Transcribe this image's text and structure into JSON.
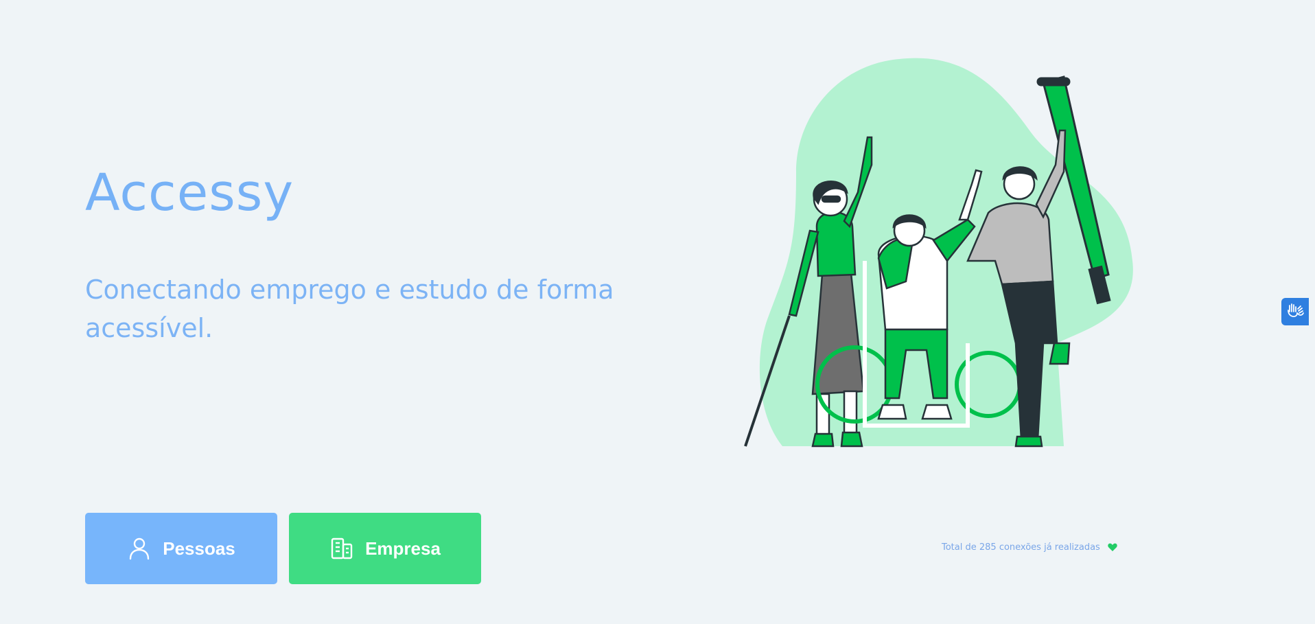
{
  "brand": {
    "title": "Accessy",
    "tagline": "Conectando emprego e estudo de forma acessível."
  },
  "actions": {
    "people_label": "Pessoas",
    "people_icon": "user-icon",
    "company_label": "Empresa",
    "company_icon": "building-icon"
  },
  "stats": {
    "connections_text": "Total de 285 conexões já realizadas",
    "icon": "heart-icon"
  },
  "accessibility": {
    "icon": "sign-language-hands-icon"
  },
  "colors": {
    "background": "#eff4f7",
    "primary_blue": "#77b5fb",
    "primary_green": "#3fdc83",
    "blob_green": "#b3f2d1",
    "illustration_green": "#00c04b"
  }
}
